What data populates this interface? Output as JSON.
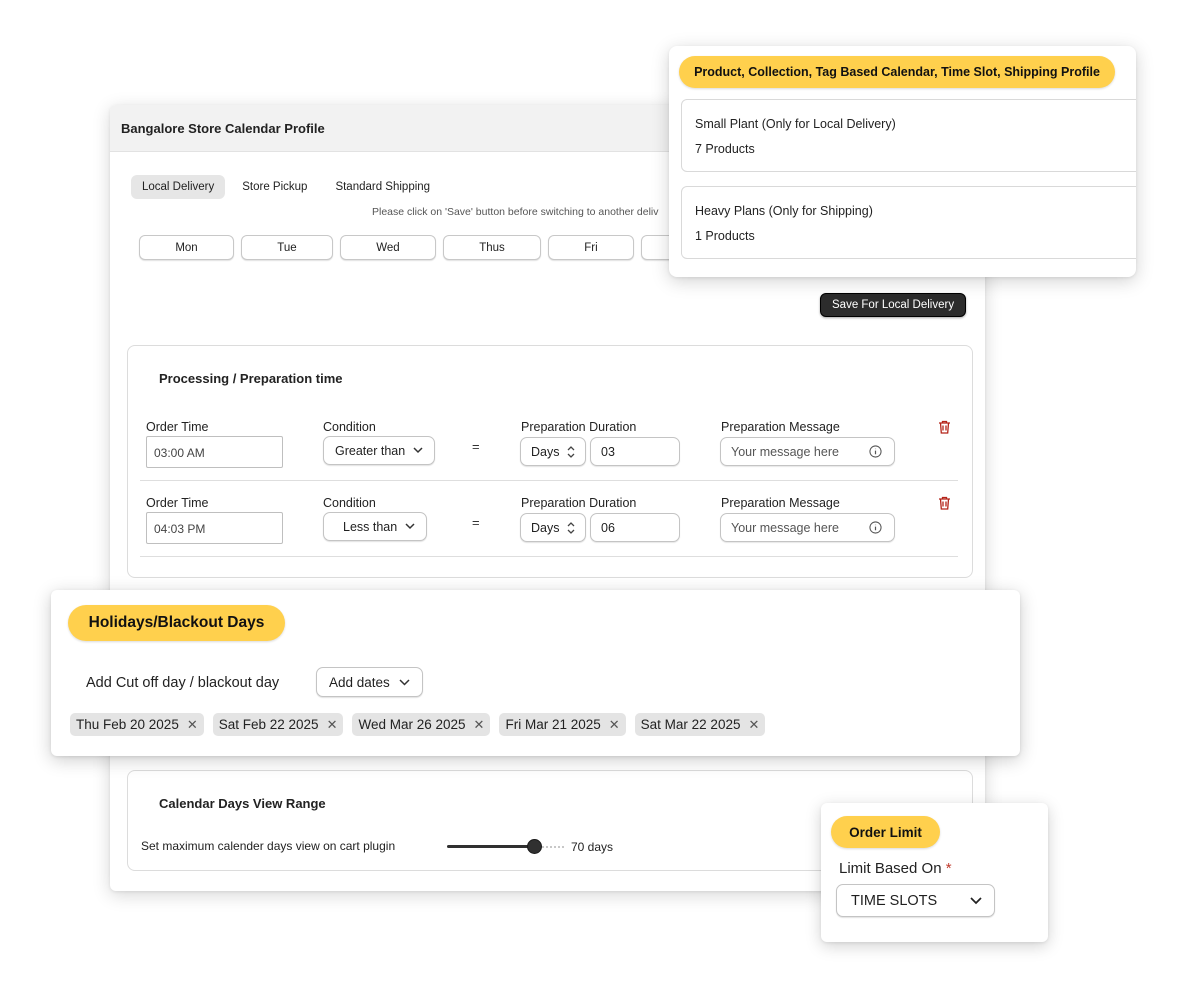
{
  "main": {
    "title": "Bangalore Store Calendar Profile",
    "tabs": [
      "Local Delivery",
      "Store Pickup",
      "Standard Shipping"
    ],
    "active_tab": "Local Delivery",
    "save_note": "Please click on 'Save' button before switching to another deliv",
    "days": [
      "Mon",
      "Tue",
      "Wed",
      "Thus",
      "Fri",
      ""
    ],
    "save_button": "Save For Local Delivery",
    "processing": {
      "title": "Processing / Preparation time",
      "rows": [
        {
          "order_time_label": "Order Time",
          "order_time": "03:00 AM",
          "condition_label": "Condition",
          "condition": "Greater than",
          "equals": "=",
          "duration_label": "Preparation Duration",
          "unit": "Days",
          "duration": "03",
          "message_label": "Preparation Message",
          "message_placeholder": "Your message here"
        },
        {
          "order_time_label": "Order Time",
          "order_time": "04:03 PM",
          "condition_label": "Condition",
          "condition": "Less than",
          "equals": "=",
          "duration_label": "Preparation Duration",
          "unit": "Days",
          "duration": "06",
          "message_label": "Preparation Message",
          "message_placeholder": "Your message here"
        }
      ]
    },
    "range": {
      "title": "Calendar Days View Range",
      "label": "Set maximum calender days view on cart plugin",
      "value_text": "70 days",
      "fraction": 0.74
    }
  },
  "product_card": {
    "badge": "Product, Collection, Tag Based Calendar, Time Slot, Shipping Profile",
    "items": [
      {
        "name": "Small Plant (Only for Local Delivery)",
        "count": "7 Products"
      },
      {
        "name": "Heavy Plans (Only for Shipping)",
        "count": "1 Products"
      }
    ]
  },
  "holidays": {
    "badge": "Holidays/Blackout Days",
    "label": "Add Cut off day / blackout day",
    "add_dates": "Add dates",
    "chips": [
      "Thu Feb 20 2025",
      "Sat Feb 22 2025",
      "Wed Mar 26 2025",
      "Fri Mar 21 2025",
      "Sat Mar 22 2025"
    ]
  },
  "order_limit": {
    "badge": "Order Limit",
    "label": "Limit Based On",
    "required_mark": "*",
    "value": "TIME SLOTS"
  },
  "colors": {
    "badge": "#ffd04d",
    "dark_button": "#2c2c2c",
    "delete": "#b42318"
  }
}
